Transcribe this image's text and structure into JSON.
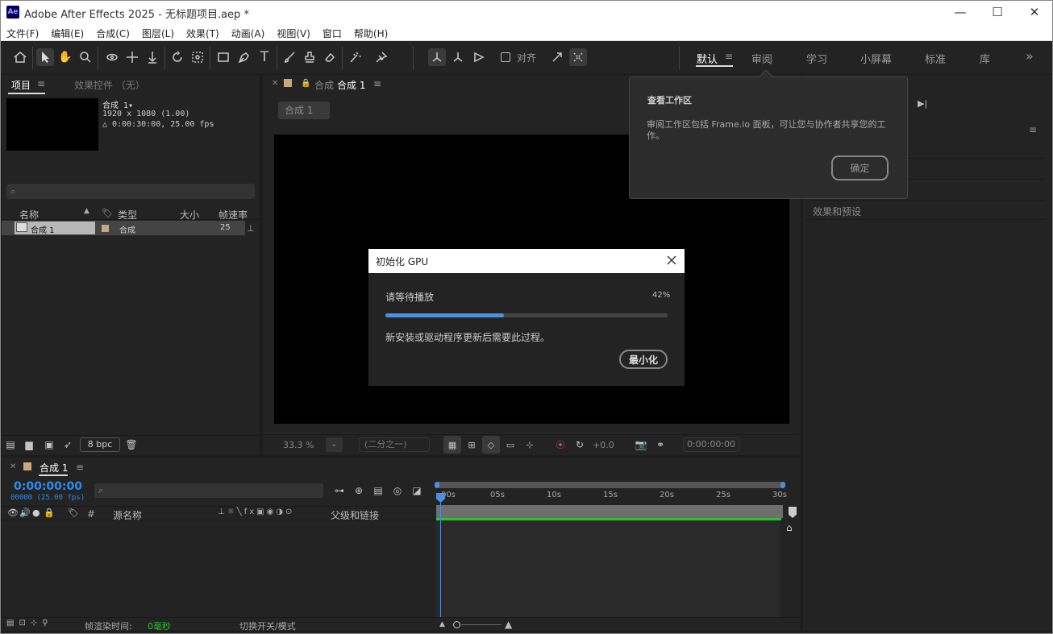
{
  "app": {
    "title": "Adobe After Effects 2025 - 无标题项目.aep *",
    "logo": "Ae"
  },
  "window_controls": {
    "minimize": "—",
    "maximize": "☐",
    "close": "✕"
  },
  "menu": [
    "文件(F)",
    "编辑(E)",
    "合成(C)",
    "图层(L)",
    "效果(T)",
    "动画(A)",
    "视图(V)",
    "窗口",
    "帮助(H)"
  ],
  "toolbar": {
    "align_label": "对齐"
  },
  "workspaces": {
    "active": "默认",
    "items": [
      "审阅",
      "学习",
      "小屏幕",
      "标准",
      "库"
    ],
    "more": "»"
  },
  "project_panel": {
    "tab_project": "项目",
    "tab_effects": "效果控件 （无）",
    "comp_name": "合成 1▾",
    "comp_res": "1920 x 1080 (1.00)",
    "comp_dur": "△ 0:00:30:00, 25.00 fps",
    "search_placeholder": "",
    "columns": [
      "名称",
      "类型",
      "大小",
      "帧速率"
    ],
    "rows": [
      {
        "name": "合成 1",
        "type": "合成",
        "size": "",
        "fps": "25"
      }
    ],
    "bpc": "8 bpc"
  },
  "comp_panel": {
    "tab_label": "合成",
    "tab_name": "合成 1",
    "breadcrumb": "合成 1",
    "zoom": "33.3 %",
    "resolution": "(二分之一)",
    "exposure": "+0.0",
    "timecode": "0:00:00:00"
  },
  "right_panel": {
    "effects_presets": "效果和预设"
  },
  "tooltip": {
    "title": "查看工作区",
    "body": "审阅工作区包括 Frame.io 面板，可让您与协作者共享您的工作。",
    "ok": "确定"
  },
  "gpu_dialog": {
    "title": "初始化 GPU",
    "waiting": "请等待播放",
    "percent": "42%",
    "progress": 0.42,
    "message": "新安装或驱动程序更新后需要此过程。",
    "minimize": "最小化"
  },
  "timeline": {
    "tab_name": "合成 1",
    "timecode": "0:00:00:00",
    "frames": "00000 (25.00 fps)",
    "col_source": "源名称",
    "col_parent": "父级和链接",
    "col_hash": "#",
    "ruler": [
      "00s",
      "05s",
      "10s",
      "15s",
      "20s",
      "25s",
      "30s"
    ],
    "render_time_label": "帧渲染时间:",
    "render_time_value": "0毫秒",
    "toggle_label": "切换开关/模式"
  },
  "colors": {
    "accent": "#4a90e2",
    "timecode": "#2d8ceb",
    "green": "#2ec02e",
    "label_tan": "#c8a97e"
  }
}
